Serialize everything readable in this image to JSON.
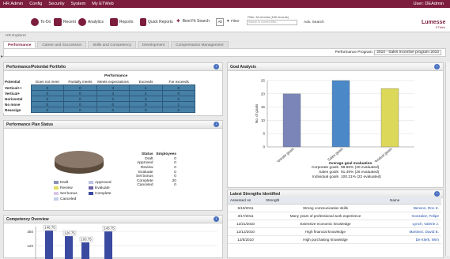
{
  "topbar": {
    "menu": [
      "HR Admin",
      "Config",
      "Security",
      "System",
      "My ETWeb"
    ],
    "user": "User: DEAdmin"
  },
  "toolbar": {
    "items": [
      {
        "label": "To-Do",
        "icon": "todo-icon"
      },
      {
        "label": "Recent",
        "icon": "folder-icon"
      },
      {
        "label": "Analytics",
        "icon": "analytics-icon"
      },
      {
        "label": "Reports",
        "icon": "reports-icon"
      },
      {
        "label": "Quick Reports",
        "icon": "quick-reports-icon"
      },
      {
        "label": "Best Fit Search",
        "icon": "best-fit-icon"
      }
    ],
    "all_label": "All",
    "filter_label": "Filter",
    "filter_status": "Filter: All records (180 records)",
    "search_placeholder": "Search in current filter...",
    "adv_search": "Adv. Search",
    "logo": "Lumesse",
    "logo_sub": "ETWeb"
  },
  "breadcrumb": "HR Explorer",
  "tabs": [
    "Performance",
    "Career and Succession",
    "Skills and Competency",
    "Development",
    "Compensation Management"
  ],
  "program": {
    "label": "Performance Program:",
    "value": "2010 - Sales Incentive program 2010"
  },
  "colors": {
    "brand": "#7d1d3e",
    "bar": "#7b85b8",
    "bar2": "#4b88c8",
    "bar3": "#dcd85a",
    "cell": "#4680a6"
  },
  "portfolio": {
    "title": "Performance/Potential Portfolio",
    "perf_label": "Performance",
    "potential_label": "Potential",
    "columns": [
      "Does not meet",
      "Partially meets",
      "Meets expectations",
      "Exceeds",
      "Far exceeds"
    ],
    "rows": [
      {
        "label": "Vertical++",
        "values": [
          "0",
          "0",
          "3",
          "1",
          "0"
        ]
      },
      {
        "label": "Vertical+",
        "values": [
          "0",
          "0",
          "3",
          "4",
          "0"
        ]
      },
      {
        "label": "Horizontal",
        "values": [
          "0",
          "0",
          "2",
          "0",
          "0"
        ]
      },
      {
        "label": "No move",
        "values": [
          "0",
          "0",
          "0",
          "0",
          "1"
        ]
      },
      {
        "label": "Reassign",
        "values": [
          "0",
          "0",
          "0",
          "0",
          "0"
        ]
      }
    ]
  },
  "plan_status": {
    "title": "Performance Plan Status",
    "legend": [
      {
        "label": "Draft",
        "color": "#8d8fb8"
      },
      {
        "label": "Approved",
        "color": "#bfc4e6"
      },
      {
        "label": "Review",
        "color": "#e2dc5c"
      },
      {
        "label": "Evaluate",
        "color": "#6b5fa8"
      },
      {
        "label": "Set bonus",
        "color": "#d9c7e5"
      },
      {
        "label": "Complete",
        "color": "#3a4aa0"
      },
      {
        "label": "Canceled",
        "color": "#c7cbe8"
      }
    ],
    "table_headers": [
      "Status",
      "Employees"
    ],
    "table": [
      [
        "Draft",
        "0"
      ],
      [
        "Approved",
        "0"
      ],
      [
        "Review",
        "0"
      ],
      [
        "Evaluate",
        "0"
      ],
      [
        "Set bonus",
        "0"
      ],
      [
        "Complete",
        "20"
      ],
      [
        "Canceled",
        "0"
      ]
    ]
  },
  "competency": {
    "title": "Competency Overview",
    "bar_labels": [
      "146.75",
      "126.75",
      "103.75",
      "143.75"
    ]
  },
  "goal_analysis": {
    "title": "Goal Analysis",
    "stats_title": "Average goal evaluation",
    "stats": [
      {
        "label": "Corporate goals",
        "value": "98.86% (20 evaluated)"
      },
      {
        "label": "Sales goals",
        "value": "91.49% (26 evaluated)"
      },
      {
        "label": "Individual goals",
        "value": "100.21% (22 evaluated)"
      }
    ]
  },
  "chart_data": [
    {
      "type": "bar",
      "title": "",
      "ylabel": "No. of goals",
      "categories": [
        "Corporate goals",
        "Sales goals",
        "Individual goals"
      ],
      "values": [
        20,
        25,
        22
      ],
      "ylim": [
        0,
        25
      ],
      "yticks": [
        0,
        5,
        10,
        15,
        20,
        25
      ],
      "grid": true,
      "colors": [
        "#7b85b8",
        "#4b88c8",
        "#dcd85a"
      ]
    },
    {
      "type": "bar",
      "title": "",
      "xlabel": "",
      "ylabel": "",
      "categories": [
        "",
        "",
        "",
        ""
      ],
      "values": [
        146.75,
        126.75,
        103.75,
        143.75
      ],
      "yticks": [
        120,
        350
      ],
      "grid": true,
      "colors": [
        "#3a4aa0",
        "#3a4aa0",
        "#3a4aa0",
        "#3a4aa0"
      ]
    }
  ],
  "strengths": {
    "title": "Latest Strengths Identified",
    "headers": [
      "Assessed on",
      "Strength",
      "Name"
    ],
    "rows": [
      [
        "5/10/2011",
        "Strong communication skills",
        "Benson, Ron K."
      ],
      [
        "3/17/2011",
        "Many years of professional work experience",
        "Gonzalez, Felipe"
      ],
      [
        "12/21/2010",
        "Extensive economic knowledge",
        "Lynch, Valerie J."
      ],
      [
        "12/12/2010",
        "High financial knowledge",
        "Martinez, David E."
      ],
      [
        "12/5/2010",
        "High purchasing knowledge",
        "De Klerk, Wim"
      ]
    ]
  }
}
